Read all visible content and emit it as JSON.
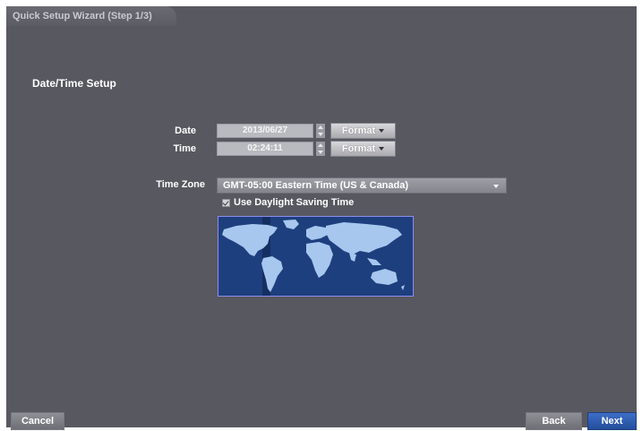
{
  "window": {
    "title": "Quick Setup Wizard (Step 1/3)",
    "section_title": "Date/Time Setup",
    "bg_color": "#585860"
  },
  "date": {
    "label": "Date",
    "value": "2013/06/27",
    "format_button": "Format"
  },
  "time": {
    "label": "Time",
    "value": "02:24:11",
    "format_button": "Format"
  },
  "timezone": {
    "label": "Time Zone",
    "selected": "GMT-05:00   Eastern Time (US & Canada)"
  },
  "daylight_saving": {
    "label": "Use Daylight Saving Time",
    "checked": true
  },
  "buttons": {
    "cancel": "Cancel",
    "back": "Back",
    "next": "Next"
  },
  "colors": {
    "accent": "#2f5db3",
    "map_ocean": "#1e3f7e",
    "map_land": "#a7c7ef"
  }
}
